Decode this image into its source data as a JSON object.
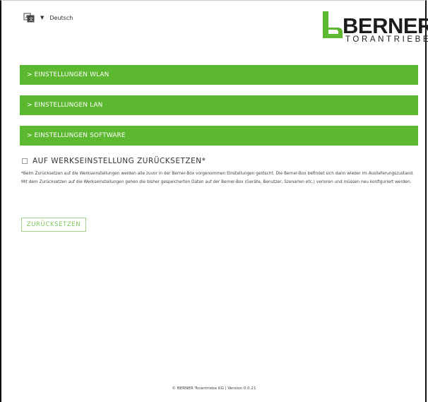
{
  "header": {
    "language": {
      "icon": "language-icon",
      "caret_icon": "caret-down-icon",
      "label": "Deutsch"
    },
    "logo": {
      "brand": "BERNER",
      "subtitle": "TORANTRIEBE",
      "brand_color": "#5cb82f"
    }
  },
  "sections": [
    {
      "chevron": ">",
      "label": "EINSTELLUNGEN WLAN"
    },
    {
      "chevron": ">",
      "label": "EINSTELLUNGEN LAN"
    },
    {
      "chevron": ">",
      "label": "EINSTELLUNGEN SOFTWARE"
    }
  ],
  "reset": {
    "checkbox_checked": false,
    "title": "AUF WERKSEINSTELLUNG ZURÜCKSETZEN*",
    "note": "*Beim Zurücksetzen auf die Werkseinstellungen werden alle zuvor in der Berner-Box vorgenommen Einstellungen gelöscht. Die Berner-Box befindet sich dann wieder im Auslieferungszustand. Mit dem Zurücksetzen auf die Werkseinstellungen gehen die bisher gespeicherten Daten auf der Berner-Box (Geräte, Benutzer, Szenarien etc.) verloren und müssen neu konfiguriert werden.",
    "button_label": "ZURÜCKSETZEN"
  },
  "footer": {
    "text": "© BERNER Torantriebe KG | Version 0.0.21"
  },
  "colors": {
    "accent": "#5cb82f",
    "button_text": "#7fc65a",
    "button_border": "#a5d48c"
  }
}
